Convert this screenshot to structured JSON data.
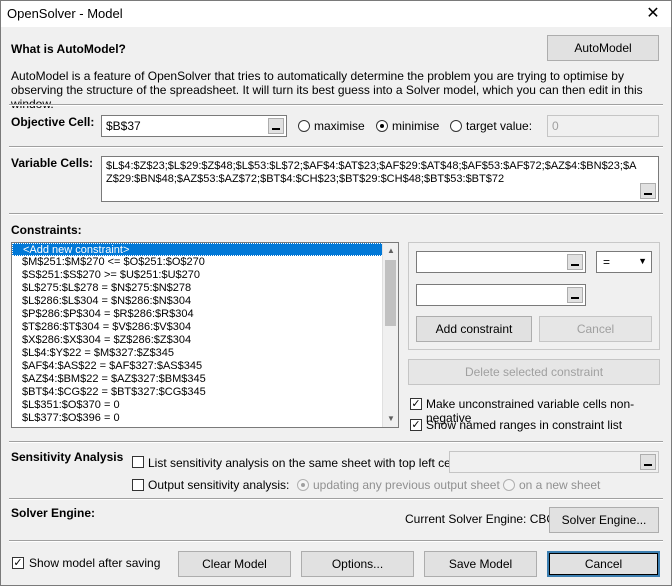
{
  "window": {
    "title": "OpenSolver - Model",
    "close_glyph": "✕"
  },
  "automodel": {
    "heading": "What is AutoModel?",
    "button": "AutoModel",
    "description": "AutoModel is a feature of OpenSolver that tries to automatically determine the problem you are trying to optimise by observing the structure of the spreadsheet. It will turn its best guess into a Solver model, which you can then edit in this window."
  },
  "objective": {
    "label": "Objective Cell:",
    "value": "$B$37",
    "options": [
      "maximise",
      "minimise",
      "target value:"
    ],
    "selected": "minimise",
    "target_value": "0"
  },
  "variables": {
    "label": "Variable Cells:",
    "value": "$L$4:$Z$23;$L$29:$Z$48;$L$53:$L$72;$AF$4:$AT$23;$AF$29:$AT$48;$AF$53:$AF$72;$AZ$4:$BN$23;$AZ$29:$BN$48;$AZ$53:$AZ$72;$BT$4:$CH$23;$BT$29:$CH$48;$BT$53:$BT$72"
  },
  "constraints": {
    "label": "Constraints:",
    "items": [
      "<Add new constraint>",
      "$M$251:$M$270 <= $O$251:$O$270",
      "$S$251:$S$270 >= $U$251:$U$270",
      "$L$275:$L$278 = $N$275:$N$278",
      "$L$286:$L$304 = $N$286:$N$304",
      "$P$286:$P$304 = $R$286:$R$304",
      "$T$286:$T$304 = $V$286:$V$304",
      "$X$286:$X$304 = $Z$286:$Z$304",
      "$L$4:$Y$22 = $M$327:$Z$345",
      "$AF$4:$AS$22 = $AF$327:$AS$345",
      "$AZ$4:$BM$22 = $AZ$327:$BM$345",
      "$BT$4:$CG$22 = $BT$327:$CG$345",
      "$L$351:$O$370 = 0",
      "$L$377:$O$396 = 0"
    ],
    "selected_index": 0,
    "relation": "=",
    "add_button": "Add constraint",
    "cancel_button": "Cancel",
    "delete_button": "Delete selected constraint",
    "nonneg_label": "Make unconstrained variable cells non-negative",
    "nonneg_checked": true,
    "named_ranges_label": "Show named ranges in constraint list",
    "named_ranges_checked": true
  },
  "sensitivity": {
    "heading": "Sensitivity Analysis",
    "list_label": "List sensitivity analysis on the same sheet with top left cell:",
    "output_label": "Output sensitivity analysis:",
    "updating_label": "updating any previous output sheet",
    "new_sheet_label": "on a new sheet"
  },
  "engine": {
    "heading": "Solver Engine:",
    "current": "Current Solver Engine: CBC",
    "button": "Solver Engine..."
  },
  "footer": {
    "show_model_label": "Show model after saving",
    "show_model_checked": true,
    "clear_button": "Clear Model",
    "options_button": "Options...",
    "save_button": "Save Model",
    "cancel_button": "Cancel"
  },
  "colors": {
    "selection": "#0078d7",
    "window_bg": "#f0f0f0"
  }
}
